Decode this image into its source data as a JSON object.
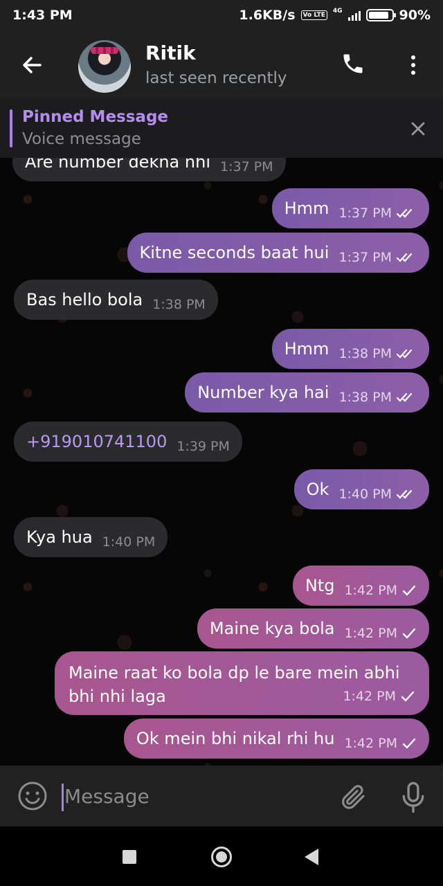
{
  "status_bar": {
    "time": "1:43 PM",
    "speed": "1.6KB/s",
    "volte": "Vo LTE",
    "network": "4G",
    "battery": "90%",
    "battery_level": 0.9
  },
  "header": {
    "contact_name": "Ritik",
    "status": "last seen recently",
    "back_icon": "arrow-left-icon",
    "call_icon": "phone-icon",
    "menu_icon": "more-vertical-icon"
  },
  "pinned": {
    "title": "Pinned Message",
    "text": "Voice message",
    "close_icon": "close-icon"
  },
  "messages": [
    {
      "dir": "in",
      "text": "Are number dekna nhi",
      "time": "1:37 PM"
    },
    {
      "dir": "out",
      "text": "Hmm",
      "time": "1:37 PM",
      "status": "read"
    },
    {
      "dir": "out",
      "text": "Kitne seconds baat hui",
      "time": "1:37 PM",
      "status": "read"
    },
    {
      "dir": "in",
      "text": "Bas hello bola",
      "time": "1:38 PM"
    },
    {
      "dir": "out",
      "text": "Hmm",
      "time": "1:38 PM",
      "status": "read"
    },
    {
      "dir": "out",
      "text": "Number kya hai",
      "time": "1:38 PM",
      "status": "read"
    },
    {
      "dir": "in",
      "text": "+919010741100",
      "time": "1:39 PM"
    },
    {
      "dir": "out",
      "text": "Ok",
      "time": "1:40 PM",
      "status": "read"
    },
    {
      "dir": "in",
      "text": "Kya hua",
      "time": "1:40 PM"
    },
    {
      "dir": "out",
      "text": "Ntg",
      "time": "1:42 PM",
      "status": "sent"
    },
    {
      "dir": "out",
      "text": "Maine kya bola",
      "time": "1:42 PM",
      "status": "sent"
    },
    {
      "dir": "out",
      "text": "Maine raat ko bola dp le bare mein abhi bhi nhi laga",
      "time": "1:42 PM",
      "status": "sent"
    },
    {
      "dir": "out",
      "text": "Ok mein bhi nikal rhi hu",
      "time": "1:42 PM",
      "status": "sent"
    }
  ],
  "input": {
    "placeholder": "Message",
    "emoji_icon": "emoji-icon",
    "attach_icon": "paperclip-icon",
    "mic_icon": "microphone-icon"
  },
  "nav": {
    "recents_icon": "square-icon",
    "home_icon": "circle-icon",
    "back_icon": "triangle-back-icon"
  },
  "colors": {
    "accent": "#a682e8",
    "outgoing_bubble_start": "#7a5aa8",
    "outgoing_bubble_pink": "#a8568f",
    "incoming_bubble": "#2b2b2d"
  }
}
